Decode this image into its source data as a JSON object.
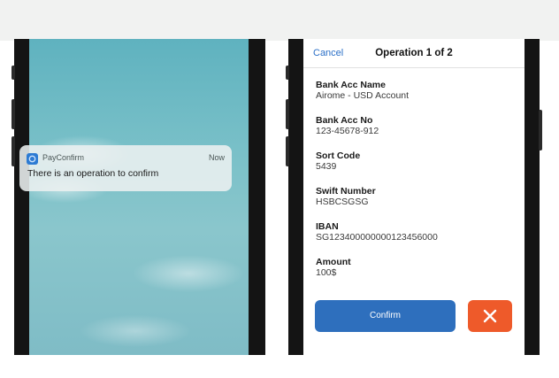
{
  "notification": {
    "app_name": "PayConfirm",
    "time": "Now",
    "message": "There is an operation to confirm"
  },
  "confirm_screen": {
    "cancel_label": "Cancel",
    "title": "Operation 1 of 2",
    "fields": [
      {
        "label": "Bank Acc Name",
        "value": "Airome - USD Account"
      },
      {
        "label": "Bank Acc No",
        "value": "123-45678-912"
      },
      {
        "label": "Sort Code",
        "value": "5439"
      },
      {
        "label": "Swift Number",
        "value": "HSBCSGSG"
      },
      {
        "label": "IBAN",
        "value": "SG123400000000123456000"
      },
      {
        "label": "Amount",
        "value": "100$"
      }
    ],
    "confirm_label": "Confirm",
    "reject_icon": "close-icon"
  },
  "colors": {
    "accent_blue": "#2e6fbd",
    "reject_orange": "#ee5a2a",
    "link_blue": "#2a6fc7"
  }
}
